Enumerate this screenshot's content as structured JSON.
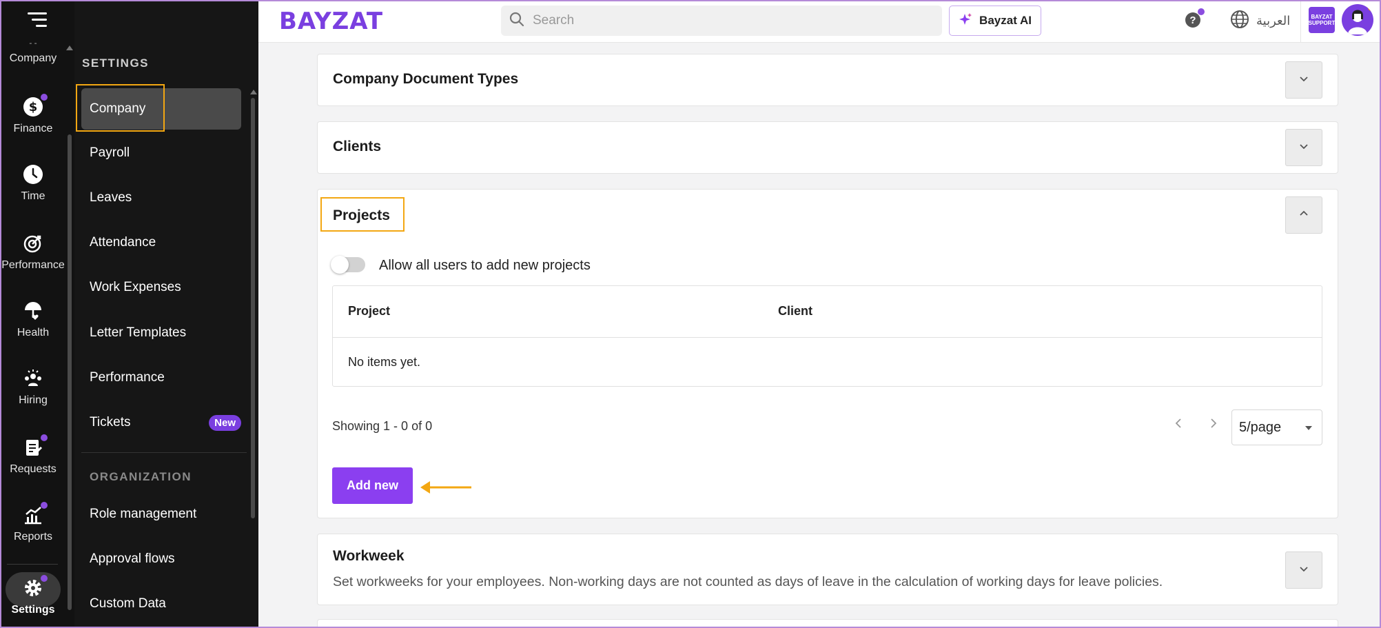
{
  "rail": {
    "items": [
      {
        "label": "Company"
      },
      {
        "label": "Finance"
      },
      {
        "label": "Time"
      },
      {
        "label": "Performance"
      },
      {
        "label": "Health"
      },
      {
        "label": "Hiring"
      },
      {
        "label": "Requests"
      },
      {
        "label": "Reports"
      },
      {
        "label": "Settings"
      }
    ]
  },
  "settings_sidebar": {
    "heading": "SETTINGS",
    "items": [
      {
        "label": "Company"
      },
      {
        "label": "Payroll"
      },
      {
        "label": "Leaves"
      },
      {
        "label": "Attendance"
      },
      {
        "label": "Work Expenses"
      },
      {
        "label": "Letter Templates"
      },
      {
        "label": "Performance"
      },
      {
        "label": "Tickets",
        "badge": "New"
      }
    ],
    "org_heading": "ORGANIZATION",
    "org_items": [
      {
        "label": "Role management"
      },
      {
        "label": "Approval flows"
      },
      {
        "label": "Custom Data"
      }
    ]
  },
  "topbar": {
    "logo": "BAYZAT",
    "search_placeholder": "Search",
    "ai_button": "Bayzat AI",
    "help": "?",
    "language": "العربية",
    "company_logo_text": "BAYZAT SUPPORT"
  },
  "main": {
    "sections": [
      {
        "title": "Company Document Types"
      },
      {
        "title": "Clients"
      },
      {
        "title": "Projects"
      },
      {
        "title": "Workweek",
        "description": "Set workweeks for your employees. Non-working days are not counted as days of leave in the calculation of working days for leave policies."
      }
    ],
    "projects": {
      "toggle_label": "Allow all users to add new projects",
      "columns": [
        "Project",
        "Client"
      ],
      "empty_text": "No items yet.",
      "showing": "Showing 1 - 0 of 0",
      "per_page": "5/page",
      "add_button": "Add new"
    }
  },
  "colors": {
    "accent": "#8b3ff0",
    "highlight": "#f3a712"
  }
}
